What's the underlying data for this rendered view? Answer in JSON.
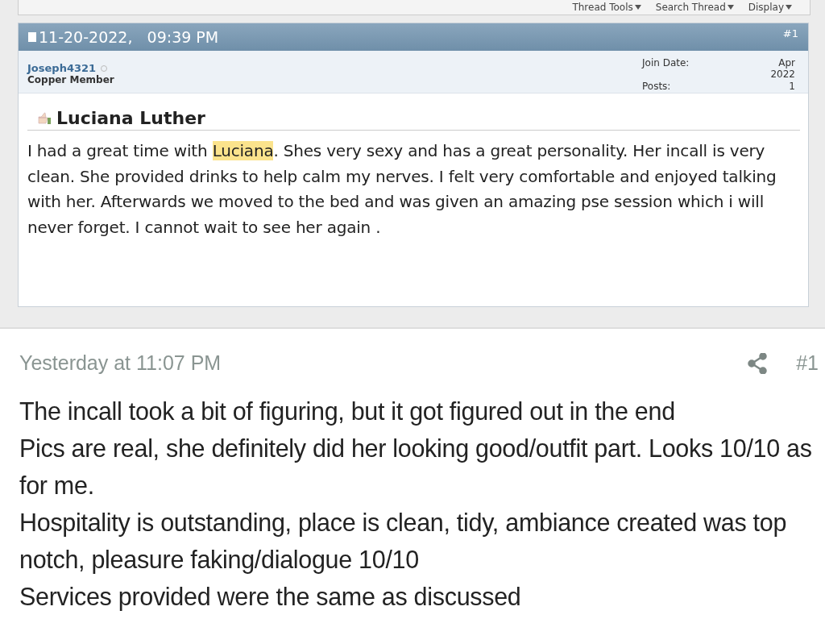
{
  "thread_toolbar": [
    "Thread Tools",
    "Search Thread",
    "Display"
  ],
  "post_1": {
    "date": "11-20-2022,",
    "time": "09:39 PM",
    "number": "#1",
    "author": "Joseph4321",
    "online": false,
    "rank": "Copper Member",
    "stats": [
      {
        "label": "Join Date:",
        "value": "Apr 2022"
      },
      {
        "label": "Posts:",
        "value": "1"
      }
    ],
    "title": "Luciana Luther",
    "body": [
      {
        "text": "I had a great time with ",
        "highlighted": false
      },
      {
        "text": "Luciana",
        "highlighted": true
      },
      {
        "text": ". Shes very sexy and has a great personality. Her incall is very clean. She provided drinks to help calm my nerves. I felt very comfortable and enjoyed talking with her. Afterwards we moved to the bed and was given an amazing pse session which i will never forget. I cannot wait to see her again .",
        "highlighted": false
      }
    ]
  },
  "post_2": {
    "date": "Yesterday at 11:07 PM",
    "number": "#1",
    "lines": [
      "The incall took a bit of figuring, but it got figured out in the end",
      "Pics are real, she definitely did her looking good/outfit part. Looks 10/10 as for me.",
      "Hospitality is outstanding, place is clean, tidy, ambiance created was top notch, pleasure faking/dialogue 10/10",
      "Services provided were the same as discussed"
    ]
  }
}
